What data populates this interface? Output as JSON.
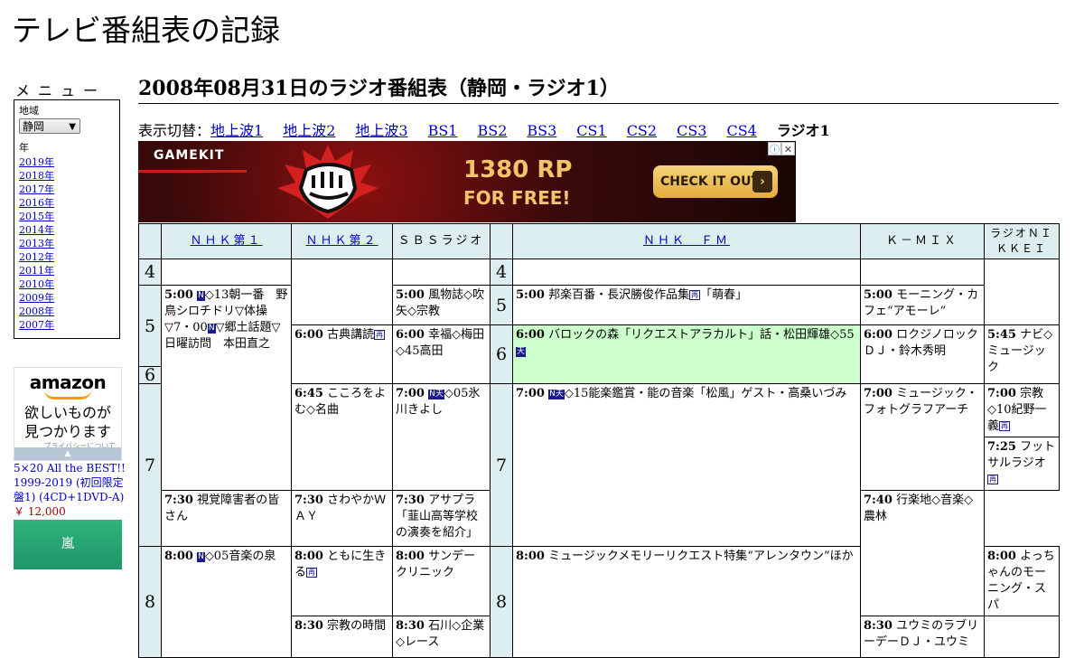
{
  "site_title": "テレビ番組表の記録",
  "menu": {
    "heading": "メニュー",
    "region_label": "地域",
    "region_value": "静岡",
    "year_label": "年",
    "years": [
      "2019年",
      "2018年",
      "2017年",
      "2016年",
      "2015年",
      "2014年",
      "2013年",
      "2012年",
      "2011年",
      "2010年",
      "2009年",
      "2008年",
      "2007年"
    ]
  },
  "ad_amazon": {
    "logo": "amazon",
    "copy_line1": "欲しいものが",
    "copy_line2": "見つかります",
    "privacy": "プライバシーについて"
  },
  "product": {
    "title": "5×20 All the BEST!! 1999-2019 (初回限定盤1) (4CD+1DVD-A)",
    "price": "￥ 12,000",
    "button": "嵐"
  },
  "page_title": "2008年08月31日のラジオ番組表（静岡・ラジオ1）",
  "switcher": {
    "label": "表示切替：",
    "links": [
      "地上波1",
      "地上波2",
      "地上波3",
      "BS1",
      "BS2",
      "BS3",
      "CS1",
      "CS2",
      "CS3",
      "CS4"
    ],
    "current": "ラジオ1"
  },
  "banner_ad": {
    "brand": "GAMEKIT",
    "headline": "1380 RP",
    "subline": "FOR FREE!",
    "cta": "CHECK IT OUT",
    "info_icon": "ⓘ",
    "close_icon": "✕"
  },
  "colors": {
    "link": "#0000cc",
    "header_bg": "#ddeef0",
    "highlight_bg": "#ccffcc"
  },
  "schedule": {
    "channels": [
      "ＮＨＫ第１",
      "ＮＨＫ第２",
      "ＳＢＳラジオ",
      "ＮＨＫ　ＦＭ",
      "Ｋ－ＭＩＸ",
      "ラジオＮＩＫＫＥＩ"
    ],
    "hours": [
      "4",
      "5",
      "6",
      "7",
      "8"
    ],
    "programs": {
      "nhk1_5": {
        "time": "5:00",
        "text": "◇13朝一番　野鳥シロチドリ▽体操▽7・00",
        "text2": "▽郷土話題▽日曜訪問　本田直之"
      },
      "nhk1_8": {
        "time": "8:00",
        "text": "◇05音楽の泉"
      },
      "nhk2_600": {
        "time": "6:00",
        "text": "古典講読"
      },
      "nhk2_645": {
        "time": "6:45",
        "text": "こころをよむ◇名曲"
      },
      "nhk2_730": {
        "time": "7:30",
        "text": "視覚障害者の皆さん"
      },
      "nhk2_800": {
        "time": "8:00",
        "text": "ともに生きる"
      },
      "nhk2_830": {
        "time": "8:30",
        "text": "宗教の時間"
      },
      "sbs_500": {
        "time": "5:00",
        "text": "風物誌◇吹矢◇宗教"
      },
      "sbs_600": {
        "time": "6:00",
        "text": "幸福◇梅田◇45高田"
      },
      "sbs_700": {
        "time": "7:00",
        "text": "◇05氷川きよし"
      },
      "sbs_730": {
        "time": "7:30",
        "text": "さわやかＷＡＹ"
      },
      "sbs_800": {
        "time": "8:00",
        "text": "サンデークリニック"
      },
      "sbs_830": {
        "time": "8:30",
        "text": "石川◇企業◇レース"
      },
      "fm_500": {
        "time": "5:00",
        "text": "邦楽百番・長沢勝俊作品集",
        "text2": "「萌春」"
      },
      "fm_600": {
        "time": "6:00",
        "text": "バロックの森「リクエストアラカルト」話・松田輝雄◇55"
      },
      "fm_700": {
        "time": "7:00",
        "text": "◇15能楽鑑賞・能の音楽「松風」ゲスト・高桑いづみ"
      },
      "fm_800": {
        "time": "8:00",
        "text": "ミュージックメモリーリクエスト特集“アレンタウン”ほか"
      },
      "kmix_500": {
        "time": "5:00",
        "text": "モーニング・カフェ“アモーレ”"
      },
      "kmix_600": {
        "time": "6:00",
        "text": "ロクジノロックＤＪ・鈴木秀明"
      },
      "kmix_700": {
        "time": "7:00",
        "text": "ミュージック・フォトグラフアーチ"
      },
      "kmix_730": {
        "time": "7:30",
        "text": "アサプラ「韮山高等学校の演奏を紹介」"
      },
      "kmix_800": {
        "time": "8:00",
        "text": "よっちゃんのモーニング・スパ"
      },
      "kmix_830": {
        "time": "8:30",
        "text": "ユウミのラブリーデーＤＪ・ユウミ"
      },
      "nikkei_545": {
        "time": "5:45",
        "text": "ナビ◇ミュージック"
      },
      "nikkei_700": {
        "time": "7:00",
        "text": "宗教◇10紀野一義"
      },
      "nikkei_725": {
        "time": "7:25",
        "text": "フットサルラジオ"
      },
      "nikkei_740": {
        "time": "7:40",
        "text": "行楽地◇音楽◇農林"
      }
    },
    "badges": {
      "n": "N",
      "ten": "天",
      "re": "再"
    }
  }
}
